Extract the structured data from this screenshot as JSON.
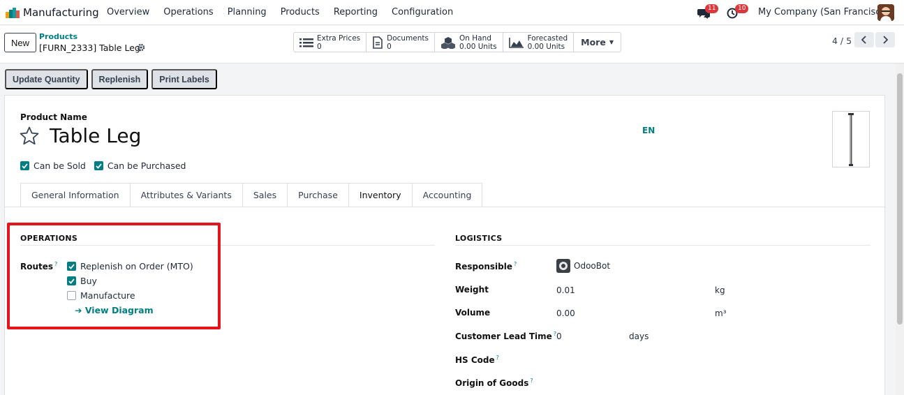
{
  "navbar": {
    "app_name": "Manufacturing",
    "menu": [
      "Overview",
      "Operations",
      "Planning",
      "Products",
      "Reporting",
      "Configuration"
    ],
    "chat_count": "11",
    "activity_count": "10",
    "company": "My Company (San Francisco)"
  },
  "control": {
    "new_label": "New",
    "breadcrumb_parent": "Products",
    "breadcrumb_current": "[FURN_2333] Table Leg",
    "smart_buttons": [
      {
        "label": "Extra Prices",
        "value": "0",
        "icon": "list-icon"
      },
      {
        "label": "Documents",
        "value": "0",
        "icon": "document-icon"
      },
      {
        "label": "On Hand",
        "value": "0.00 Units",
        "icon": "cubes-icon"
      },
      {
        "label": "Forecasted",
        "value": "0.00 Units",
        "icon": "area-chart-icon"
      }
    ],
    "more_label": "More",
    "pager": "4 / 5"
  },
  "actions": [
    "Update Quantity",
    "Replenish",
    "Print Labels"
  ],
  "product": {
    "name_label": "Product Name",
    "name": "Table Leg",
    "lang": "EN",
    "can_be_sold": "Can be Sold",
    "can_be_purchased": "Can be Purchased"
  },
  "tabs": [
    "General Information",
    "Attributes & Variants",
    "Sales",
    "Purchase",
    "Inventory",
    "Accounting"
  ],
  "active_tab": "Inventory",
  "operations": {
    "title": "OPERATIONS",
    "routes_label": "Routes",
    "routes": [
      {
        "label": "Replenish on Order (MTO)",
        "checked": true
      },
      {
        "label": "Buy",
        "checked": true
      },
      {
        "label": "Manufacture",
        "checked": false
      }
    ],
    "view_diagram": "View Diagram"
  },
  "logistics": {
    "title": "LOGISTICS",
    "responsible_label": "Responsible",
    "responsible": "OdooBot",
    "weight_label": "Weight",
    "weight": "0.01",
    "weight_unit": "kg",
    "volume_label": "Volume",
    "volume": "0.00",
    "volume_unit": "m³",
    "lead_time_label": "Customer Lead Time",
    "lead_time": "0",
    "lead_time_unit": "days",
    "hs_code_label": "HS Code",
    "origin_label": "Origin of Goods"
  },
  "colors": {
    "accent": "#017e84",
    "highlight": "#e4141b",
    "badge": "#d9393e"
  }
}
